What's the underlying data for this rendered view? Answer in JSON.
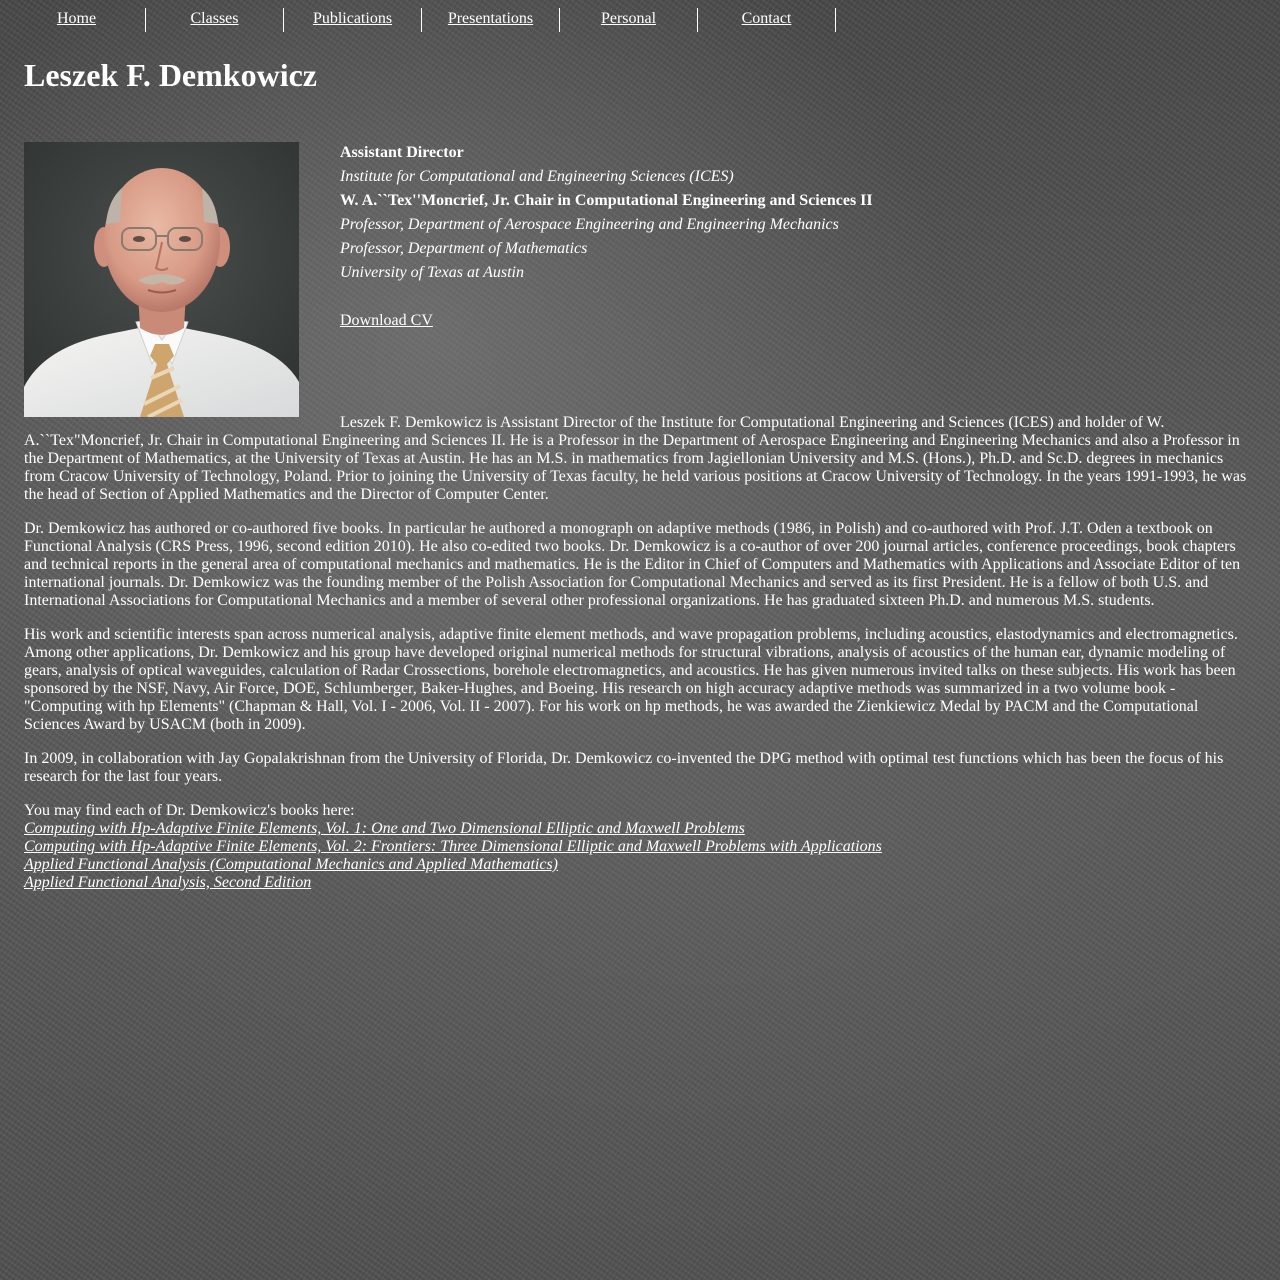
{
  "nav": {
    "items": [
      "Home",
      "Classes",
      "Publications",
      "Presentations",
      "Personal",
      "Contact"
    ]
  },
  "header": {
    "title": "Leszek F. Demkowicz"
  },
  "titles": {
    "line1": "Assistant Director",
    "line2": "Institute for Computational and Engineering Sciences (ICES)",
    "line3": "W. A.``Tex''Moncrief, Jr. Chair in Computational Engineering and Sciences II",
    "line4": "Professor, Department of Aerospace Engineering and Engineering Mechanics",
    "line5": "Professor, Department of Mathematics",
    "line6": "University of Texas at Austin"
  },
  "cv": {
    "label": "Download CV"
  },
  "bio": {
    "p1": "Leszek F. Demkowicz is Assistant Director of the Institute for Computational Engineering and Sciences (ICES) and holder of W. A.``Tex\"Moncrief, Jr. Chair in Computational Engineering and Sciences II. He is a Professor in the Department of Aerospace Engineering and Engineering Mechanics and also a Professor in the Department of Mathematics, at the University of Texas at Austin. He has an M.S. in mathematics from Jagiellonian University and M.S. (Hons.), Ph.D. and Sc.D. degrees in mechanics from Cracow University of Technology, Poland. Prior to joining the University of Texas faculty, he held various positions at Cracow University of Technology. In the years 1991-1993, he was the head of Section of Applied Mathematics and the Director of Computer Center.",
    "p2": "Dr. Demkowicz has authored or co-authored five books. In particular he authored a monograph on adaptive methods (1986, in Polish) and co-authored with Prof. J.T. Oden a textbook on Functional Analysis (CRS Press, 1996, second edition 2010). He also co-edited two books. Dr. Demkowicz is a co-author of over 200 journal articles, conference proceedings, book chapters and technical reports in the general area of computational mechanics and mathematics. He is the Editor in Chief of Computers and Mathematics with Applications and Associate Editor of ten international journals. Dr. Demkowicz was the founding member of the Polish Association for Computational Mechanics and served as its first President. He is a fellow of both U.S. and International Associations for Computational Mechanics and a member of several other professional organizations. He has graduated sixteen Ph.D. and numerous M.S. students.",
    "p3": "His work and scientific interests span across numerical analysis, adaptive finite element methods, and wave propagation problems, including acoustics, elastodynamics and electromagnetics. Among other applications, Dr. Demkowicz and his group have developed original numerical methods for structural vibrations, analysis of acoustics of the human ear, dynamic modeling of gears, analysis of optical waveguides, calculation of Radar Crossections, borehole electromagnetics, and acoustics. He has given numerous invited talks on these subjects. His work has been sponsored by the NSF, Navy, Air Force, DOE, Schlumberger, Baker-Hughes, and Boeing. His research on high accuracy adaptive methods was summarized in a two volume book - \"Computing with hp Elements\" (Chapman & Hall, Vol. I - 2006, Vol. II - 2007). For his work on hp methods, he was awarded the Zienkiewicz Medal by PACM and the Computational Sciences Award by USACM (both in 2009).",
    "p4": "In 2009, in collaboration with Jay Gopalakrishnan from the University of Florida, Dr. Demkowicz co-invented the DPG method with optimal test functions which has been the focus of his research for the last four years."
  },
  "books": {
    "intro": "You may find each of Dr. Demkowicz's books here:",
    "items": [
      "Computing with Hp-Adaptive Finite Elements, Vol. 1: One and Two Dimensional Elliptic and Maxwell Problems",
      "Computing with Hp-Adaptive Finite Elements, Vol. 2: Frontiers: Three Dimensional Elliptic and Maxwell Problems with Applications",
      "Applied Functional Analysis (Computational Mechanics and Applied Mathematics)",
      "Applied Functional Analysis, Second Edition"
    ]
  },
  "colors": {
    "text": "#ffffff",
    "background": "#565656"
  }
}
